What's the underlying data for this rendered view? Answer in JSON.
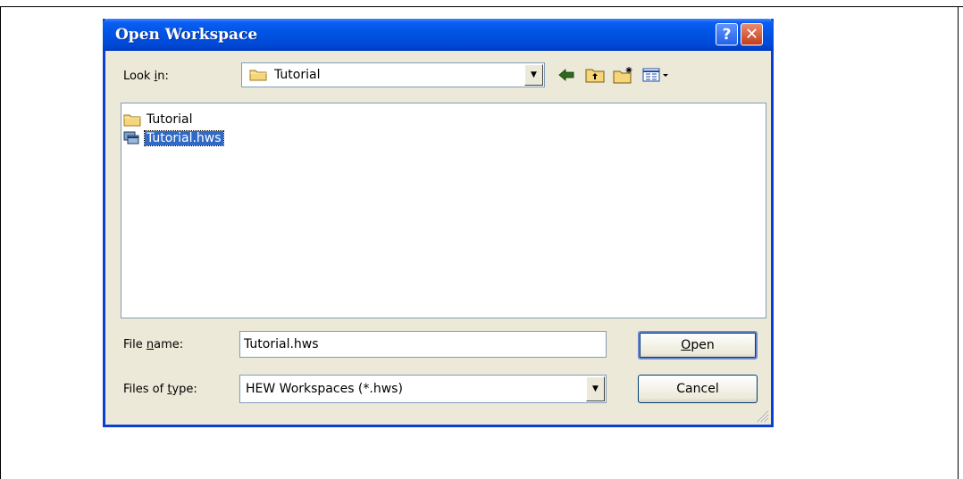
{
  "dialog": {
    "title": "Open Workspace",
    "help_glyph": "?",
    "close_glyph": "✕"
  },
  "look_in": {
    "label_prefix": "Look ",
    "label_access": "i",
    "label_suffix": "n:",
    "value": "Tutorial",
    "icons": [
      "back-arrow-icon",
      "up-one-level-icon",
      "new-folder-icon",
      "view-menu-icon"
    ]
  },
  "file_list": {
    "items": [
      {
        "name": "Tutorial",
        "icon": "folder-icon",
        "selected": false
      },
      {
        "name": "Tutorial.hws",
        "icon": "workspace-file-icon",
        "selected": true
      }
    ]
  },
  "file_name": {
    "label_prefix": "File ",
    "label_access": "n",
    "label_suffix": "ame:",
    "value": "Tutorial.hws"
  },
  "file_type": {
    "label_prefix": "Files of ",
    "label_access": "t",
    "label_suffix": "ype:",
    "value": "HEW Workspaces (*.hws)"
  },
  "buttons": {
    "open_access": "O",
    "open_rest": "pen",
    "cancel": "Cancel"
  },
  "colors": {
    "titlebar": "#0054e3",
    "selection": "#316ac5",
    "dialog_bg": "#ece9d8"
  }
}
